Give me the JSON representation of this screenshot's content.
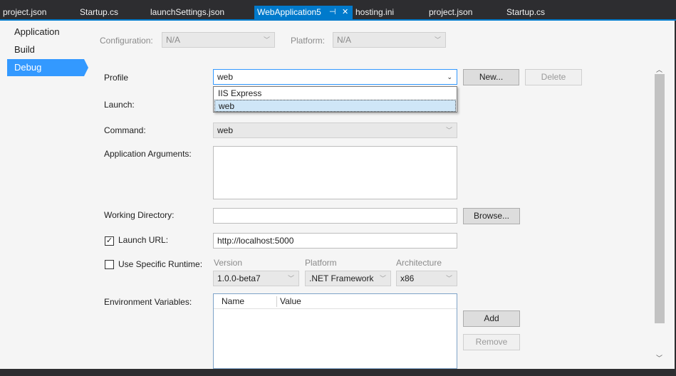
{
  "tabs": [
    {
      "label": "project.json"
    },
    {
      "label": "Startup.cs"
    },
    {
      "label": "launchSettings.json"
    },
    {
      "label": "WebApplication5",
      "pin": "⊣",
      "close": "✕"
    },
    {
      "label": "hosting.ini"
    },
    {
      "label": "project.json"
    },
    {
      "label": "Startup.cs"
    }
  ],
  "nav": {
    "items": [
      {
        "label": "Application"
      },
      {
        "label": "Build"
      },
      {
        "label": "Debug"
      }
    ]
  },
  "config": {
    "configuration_label": "Configuration:",
    "configuration_value": "N/A",
    "platform_label": "Platform:",
    "platform_value": "N/A"
  },
  "profile": {
    "label": "Profile",
    "value": "web",
    "new_button": "New...",
    "delete_button": "Delete",
    "options": [
      "IIS Express",
      "web"
    ]
  },
  "launch": {
    "label": "Launch:"
  },
  "command": {
    "label": "Command:",
    "value": "web"
  },
  "app_args": {
    "label": "Application Arguments:",
    "value": ""
  },
  "working_dir": {
    "label": "Working Directory:",
    "value": "",
    "browse_button": "Browse..."
  },
  "launch_url": {
    "label": "Launch URL:",
    "checked": true,
    "check_glyph": "✓",
    "value": "http://localhost:5000"
  },
  "runtime": {
    "label": "Use Specific Runtime:",
    "checked": false,
    "version_label": "Version",
    "version_value": "1.0.0-beta7",
    "platform_label": "Platform",
    "platform_value": ".NET Framework",
    "arch_label": "Architecture",
    "arch_value": "x86"
  },
  "env": {
    "label": "Environment Variables:",
    "columns": [
      "Name",
      "Value"
    ],
    "add_button": "Add",
    "remove_button": "Remove"
  },
  "colors": {
    "accent": "#007acc",
    "nav_selected": "#3399ff",
    "chrome": "#2d2d30",
    "page": "#f5f5f5"
  },
  "icons": {
    "chevron": "chevron-down-icon",
    "pin": "pin-icon",
    "close": "close-icon"
  }
}
